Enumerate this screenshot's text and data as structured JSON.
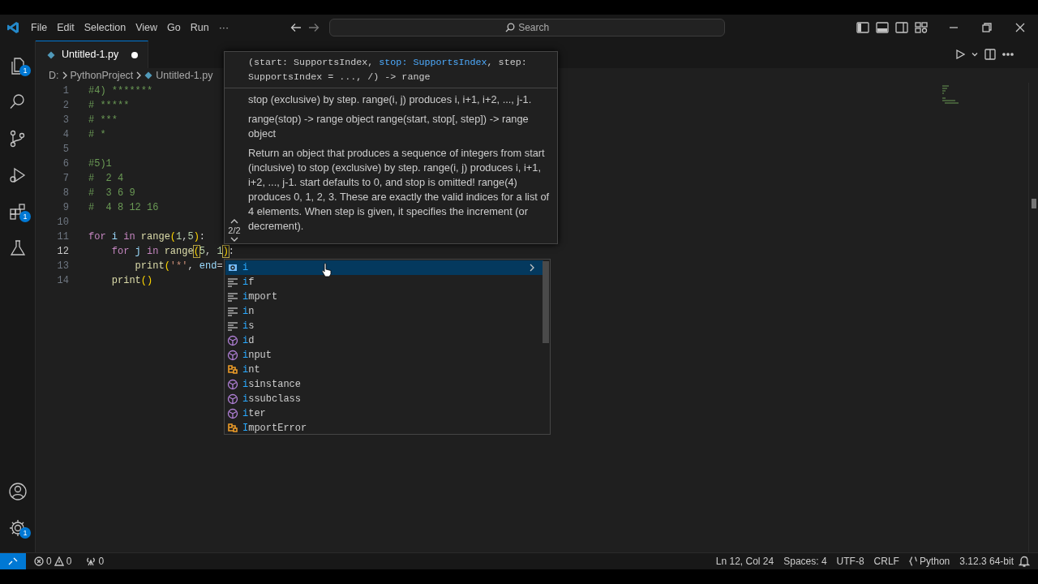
{
  "title_bar": {
    "menu": [
      "File",
      "Edit",
      "Selection",
      "View",
      "Go",
      "Run",
      "···"
    ],
    "search": {
      "placeholder": "Search"
    }
  },
  "activity_bar": {
    "items": [
      {
        "kind": "explorer",
        "badge": "1"
      },
      {
        "kind": "search"
      },
      {
        "kind": "source-control"
      },
      {
        "kind": "run"
      },
      {
        "kind": "extensions",
        "badge": "1"
      },
      {
        "kind": "testing"
      }
    ],
    "bottom": [
      {
        "kind": "account"
      },
      {
        "kind": "settings",
        "badge": "1"
      }
    ]
  },
  "tabs": [
    {
      "label": "Untitled-1.py",
      "selected": true,
      "modified": true
    }
  ],
  "breadcrumb": [
    "D:",
    "PythonProject",
    "Untitled-1.py"
  ],
  "editor": {
    "lines": [
      {
        "number": "1",
        "current": false,
        "tokens": [
          {
            "kind": "comment",
            "text": "#4) *******"
          }
        ]
      },
      {
        "number": "2",
        "current": false,
        "tokens": [
          {
            "kind": "comment",
            "text": "# *****"
          }
        ]
      },
      {
        "number": "3",
        "current": false,
        "tokens": [
          {
            "kind": "comment",
            "text": "# ***"
          }
        ]
      },
      {
        "number": "4",
        "current": false,
        "tokens": [
          {
            "kind": "comment",
            "text": "# *"
          }
        ]
      },
      {
        "number": "5",
        "current": false
      },
      {
        "number": "6",
        "current": false,
        "tokens": [
          {
            "kind": "comment",
            "text": "#5)1"
          }
        ]
      },
      {
        "number": "7",
        "current": false,
        "tokens": [
          {
            "kind": "comment",
            "text": "#  2 4"
          }
        ]
      },
      {
        "number": "8",
        "current": false,
        "tokens": [
          {
            "kind": "comment",
            "text": "#  3 6 9"
          }
        ]
      },
      {
        "number": "9",
        "current": false,
        "tokens": [
          {
            "kind": "comment",
            "text": "#  4 8 12 16"
          }
        ]
      },
      {
        "number": "10",
        "current": false
      },
      {
        "number": "11",
        "current": false,
        "tokens": [
          {
            "kind": "keyword",
            "text": "for "
          },
          {
            "kind": "variable",
            "text": "i "
          },
          {
            "kind": "keyword",
            "text": "in "
          },
          {
            "kind": "function",
            "text": "range"
          },
          {
            "kind": "bracket",
            "text": "(",
            "matched": false
          },
          {
            "kind": "number",
            "text": "1"
          },
          {
            "kind": "plain",
            "text": ","
          },
          {
            "kind": "number",
            "text": "5"
          },
          {
            "kind": "bracket",
            "text": ")",
            "matched": false
          },
          {
            "kind": "plain",
            "text": ":"
          }
        ]
      },
      {
        "number": "12",
        "current": true,
        "tokens": [
          {
            "kind": "keyword",
            "text": "    for "
          },
          {
            "kind": "variable",
            "text": "j "
          },
          {
            "kind": "keyword",
            "text": "in "
          },
          {
            "kind": "function",
            "text": "range"
          },
          {
            "kind": "bracket",
            "text": "(",
            "matched": true
          },
          {
            "kind": "number",
            "text": "5"
          },
          {
            "kind": "plain",
            "text": ", "
          },
          {
            "kind": "number",
            "text": "1"
          },
          {
            "kind": "bracket",
            "text": ")",
            "matched": true
          },
          {
            "kind": "plain",
            "text": ":"
          }
        ]
      },
      {
        "number": "13",
        "current": false,
        "tokens": [
          {
            "kind": "function",
            "text": "        print"
          },
          {
            "kind": "bracket",
            "text": "(",
            "matched": false
          },
          {
            "kind": "string",
            "text": "'*'"
          },
          {
            "kind": "plain",
            "text": ", "
          },
          {
            "kind": "variable",
            "text": "end"
          },
          {
            "kind": "plain",
            "text": "="
          }
        ]
      },
      {
        "number": "14",
        "current": false,
        "tokens": [
          {
            "kind": "function",
            "text": "    print"
          },
          {
            "kind": "bracket",
            "text": "()",
            "matched": false
          }
        ]
      }
    ]
  },
  "hover": {
    "signature": [
      {
        "text": "(start: SupportsIndex, ",
        "active": false
      },
      {
        "text": "stop: SupportsIndex",
        "active": true
      },
      {
        "text": ", step: SupportsIndex = ..., /) -> range",
        "active": false
      }
    ],
    "paragraphs": [
      "stop (exclusive) by step.  range(i, j) produces i, i+1, i+2, ..., j-1.",
      "range(stop) -> range object range(start, stop[, step]) -> range object",
      "Return an object that produces a sequence of integers from start (inclusive) to stop (exclusive) by step. range(i, j) produces i, i+1, i+2, ..., j-1. start defaults to 0, and stop is omitted! range(4) produces 0, 1, 2, 3. These are exactly the valid indices for a list of 4 elements. When step is given, it specifies the increment (or decrement)."
    ],
    "counter": "2/2"
  },
  "suggestions": [
    {
      "label": "i",
      "kind": "variable",
      "selected": true
    },
    {
      "label": "if",
      "kind": "keyword",
      "selected": false
    },
    {
      "label": "import",
      "kind": "keyword",
      "selected": false
    },
    {
      "label": "in",
      "kind": "keyword",
      "selected": false
    },
    {
      "label": "is",
      "kind": "keyword",
      "selected": false
    },
    {
      "label": "id",
      "kind": "function",
      "selected": false
    },
    {
      "label": "input",
      "kind": "function",
      "selected": false
    },
    {
      "label": "int",
      "kind": "class",
      "selected": false
    },
    {
      "label": "isinstance",
      "kind": "function",
      "selected": false
    },
    {
      "label": "issubclass",
      "kind": "function",
      "selected": false
    },
    {
      "label": "iter",
      "kind": "function",
      "selected": false
    },
    {
      "label": "ImportError",
      "kind": "class",
      "selected": false
    }
  ],
  "status_bar": {
    "errors": "0",
    "warnings": "0",
    "ports": "0",
    "right": [
      {
        "kind": "text",
        "text": "Ln 12, Col 24"
      },
      {
        "kind": "text",
        "text": "Spaces: 4"
      },
      {
        "kind": "text",
        "text": "UTF-8"
      },
      {
        "kind": "text",
        "text": "CRLF"
      },
      {
        "kind": "language",
        "text": "Python"
      },
      {
        "kind": "text",
        "text": "3.12.3 64-bit"
      }
    ]
  }
}
